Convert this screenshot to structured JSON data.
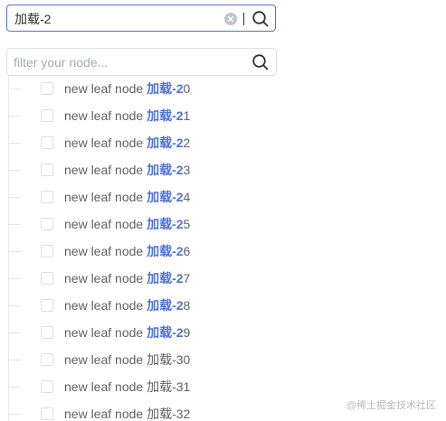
{
  "search": {
    "value": "加载-2"
  },
  "filter": {
    "placeholder": "filter your node..."
  },
  "icons": {
    "clear": "circle-close-icon",
    "search": "search-icon"
  },
  "colors": {
    "accent": "#4f73d6",
    "border": "#dcdfe6",
    "text": "#606266"
  },
  "tree": {
    "items": [
      {
        "prefix": "new leaf node ",
        "highlight": "加载-2",
        "suffix": "0"
      },
      {
        "prefix": "new leaf node ",
        "highlight": "加载-2",
        "suffix": "1"
      },
      {
        "prefix": "new leaf node ",
        "highlight": "加载-2",
        "suffix": "2"
      },
      {
        "prefix": "new leaf node ",
        "highlight": "加载-2",
        "suffix": "3"
      },
      {
        "prefix": "new leaf node ",
        "highlight": "加载-2",
        "suffix": "4"
      },
      {
        "prefix": "new leaf node ",
        "highlight": "加载-2",
        "suffix": "5"
      },
      {
        "prefix": "new leaf node ",
        "highlight": "加载-2",
        "suffix": "6"
      },
      {
        "prefix": "new leaf node ",
        "highlight": "加载-2",
        "suffix": "7"
      },
      {
        "prefix": "new leaf node ",
        "highlight": "加载-2",
        "suffix": "8"
      },
      {
        "prefix": "new leaf node ",
        "highlight": "加载-2",
        "suffix": "9"
      },
      {
        "prefix": "new leaf node 加载-30",
        "highlight": "",
        "suffix": ""
      },
      {
        "prefix": "new leaf node 加载-31",
        "highlight": "",
        "suffix": ""
      },
      {
        "prefix": "new leaf node 加载-32",
        "highlight": "",
        "suffix": ""
      }
    ]
  },
  "watermark": "@稀土掘金技术社区"
}
